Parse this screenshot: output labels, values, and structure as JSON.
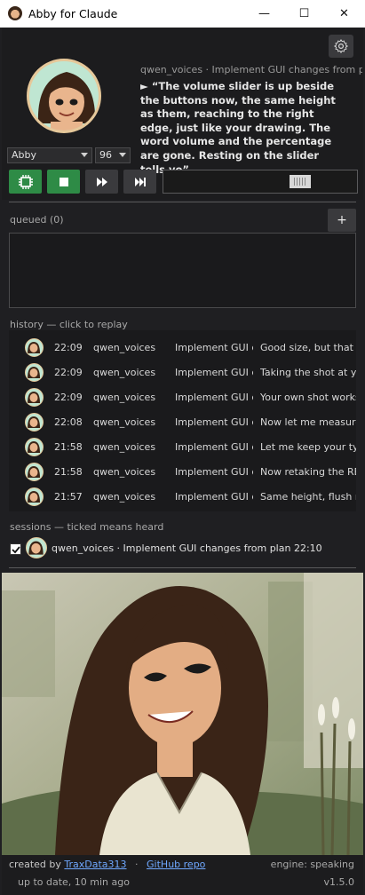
{
  "window": {
    "title": "Abby for Claude",
    "minimize_glyph": "—",
    "maximize_glyph": "☐",
    "close_glyph": "✕"
  },
  "current": {
    "meta": "qwen_voices · Implement GUI changes from pla",
    "quote": "► “The volume slider is up beside the buttons now, the same height as them, reaching to the right edge, just like your drawing. The word volume and the percentage are gone. Resting on the slider tells yo”"
  },
  "controls": {
    "voice": "Abby",
    "rate": "96",
    "volume_fraction": 0.73,
    "icons": [
      "chip-icon",
      "stop-icon",
      "fast-forward-icon",
      "skip-next-icon"
    ]
  },
  "queue": {
    "label": "queued (0)",
    "add_label": "+"
  },
  "history": {
    "label": "history — click to replay",
    "rows": [
      {
        "time": "22:09",
        "agent": "qwen_voices",
        "project": "Implement GUI ch",
        "message": "Good size, but that li"
      },
      {
        "time": "22:09",
        "agent": "qwen_voices",
        "project": "Implement GUI ch",
        "message": "Taking the shot at yo"
      },
      {
        "time": "22:09",
        "agent": "qwen_voices",
        "project": "Implement GUI ch",
        "message": "Your own shot works"
      },
      {
        "time": "22:08",
        "agent": "qwen_voices",
        "project": "Implement GUI ch",
        "message": "Now let me measure"
      },
      {
        "time": "21:58",
        "agent": "qwen_voices",
        "project": "Implement GUI ch",
        "message": "Let me keep your typ"
      },
      {
        "time": "21:58",
        "agent": "qwen_voices",
        "project": "Implement GUI ch",
        "message": "Now retaking the RE."
      },
      {
        "time": "21:57",
        "agent": "qwen_voices",
        "project": "Implement GUI ch",
        "message": "Same height, flush ri"
      }
    ]
  },
  "sessions": {
    "label": "sessions — ticked means heard",
    "items": [
      {
        "checked": true,
        "text": "qwen_voices · Implement GUI changes from plan  22:10"
      }
    ]
  },
  "footer": {
    "created_by": "created by",
    "author_link": "TraxData313",
    "separator": "·",
    "repo_link": "GitHub repo",
    "engine": "engine: speaking",
    "status": "up to date, 10 min ago",
    "version": "v1.5.0"
  },
  "colors": {
    "accent_green": "#2e8b46",
    "link": "#6fa8ff",
    "background": "#1f1f22"
  }
}
